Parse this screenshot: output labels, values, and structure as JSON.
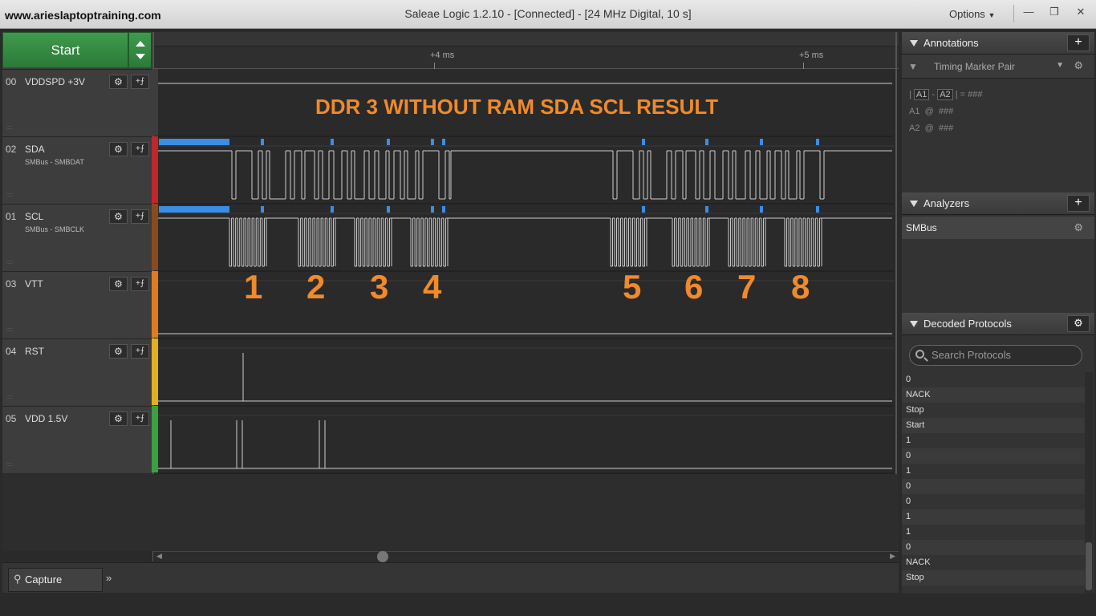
{
  "window": {
    "watermark": "www.arieslaptoptraining.com",
    "title": "Saleae Logic 1.2.10 - [Connected] - [24 MHz Digital, 10 s]",
    "options_label": "Options",
    "minimize": "—",
    "restore": "❐",
    "close": "✕"
  },
  "capture": {
    "start_label": "Start"
  },
  "ruler": {
    "tick_1": "+4 ms",
    "tick_2": "+5 ms"
  },
  "channels": [
    {
      "num": "00",
      "name": "VDDSPD +3V",
      "sub": "",
      "color": "#3d3d3d"
    },
    {
      "num": "02",
      "name": "SDA",
      "sub": "SMBus - SMBDAT",
      "color": "#c0262a"
    },
    {
      "num": "01",
      "name": "SCL",
      "sub": "SMBus - SMBCLK",
      "color": "#8a4a1c"
    },
    {
      "num": "03",
      "name": "VTT",
      "sub": "",
      "color": "#e07b20"
    },
    {
      "num": "04",
      "name": "RST",
      "sub": "",
      "color": "#e0b020"
    },
    {
      "num": "05",
      "name": "VDD 1.5V",
      "sub": "",
      "color": "#3aa040"
    }
  ],
  "overlay": {
    "title": "DDR 3 WITHOUT RAM SDA SCL RESULT",
    "numbers": [
      "1",
      "2",
      "3",
      "4",
      "5",
      "6",
      "7",
      "8"
    ]
  },
  "bottom": {
    "capture_tab": "Capture"
  },
  "annotations": {
    "header": "Annotations",
    "add": "+",
    "timing_marker": "Timing Marker Pair",
    "pipe_left": "|",
    "a1": "A1",
    "dash": "-",
    "a2": "A2",
    "pipe_right": "|",
    "equals": "=",
    "hash": "###",
    "a1_line": "A1",
    "a2_line": "A2",
    "at": "@"
  },
  "analyzers": {
    "header": "Analyzers",
    "add": "+",
    "items": [
      "SMBus"
    ]
  },
  "decoded": {
    "header": "Decoded Protocols",
    "search_placeholder": "Search Protocols",
    "items": [
      "0",
      "NACK",
      "Stop",
      "Start",
      "1",
      "0",
      "1",
      "0",
      "0",
      "1",
      "1",
      "0",
      "NACK",
      "Stop"
    ]
  }
}
